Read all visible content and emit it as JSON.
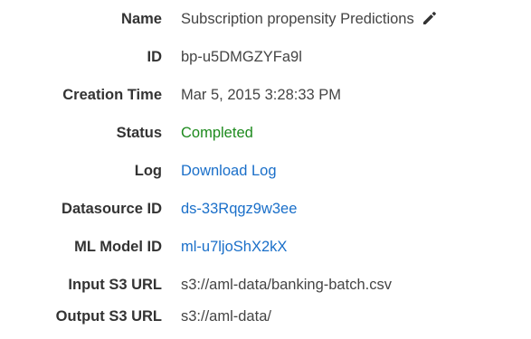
{
  "details": {
    "name": {
      "label": "Name",
      "value": "Subscription propensity Predictions",
      "edit_icon": "pencil-icon"
    },
    "id": {
      "label": "ID",
      "value": "bp-u5DMGZYFa9l"
    },
    "creation_time": {
      "label": "Creation Time",
      "value": "Mar 5, 2015 3:28:33 PM"
    },
    "status": {
      "label": "Status",
      "value": "Completed",
      "color": "#1d8a1d"
    },
    "log": {
      "label": "Log",
      "value": "Download Log",
      "color": "#1a6fc9"
    },
    "datasource_id": {
      "label": "Datasource ID",
      "value": "ds-33Rqgz9w3ee"
    },
    "ml_model_id": {
      "label": "ML Model ID",
      "value": "ml-u7ljoShX2kX"
    },
    "input_s3_url": {
      "label": "Input S3 URL",
      "value": "s3://aml-data/banking-batch.csv"
    },
    "output_s3_url": {
      "label": "Output S3 URL",
      "value": "s3://aml-data/"
    }
  }
}
